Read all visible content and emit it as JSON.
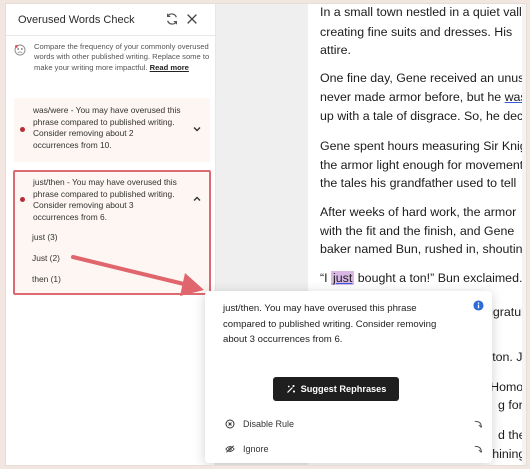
{
  "panel": {
    "title": "Overused Words Check",
    "refresh_icon": "refresh-icon",
    "close_icon": "close-icon",
    "intro": "Compare the frequency of your commonly overused words with other published writing. Replace some to make your writing more impactful.",
    "read_more": "Read more"
  },
  "cards": [
    {
      "text": "was/were - You may have overused this phrase compared to published writing. Consider removing about 2 occurrences from 10.",
      "expanded": false
    },
    {
      "text": "just/then - You may have overused this phrase compared to published writing. Consider removing about 3 occurrences from 6.",
      "expanded": true,
      "occurrences": [
        "just (3)",
        "Just (2)",
        "then (1)"
      ]
    }
  ],
  "document": {
    "lines": [
      "In a small town nestled in a quiet valley,",
      "creating fine suits and dresses. His",
      "attire.",
      "One fine day, Gene received an unusual",
      "never made armor before, but he",
      "up with a tale of disgrace. So, he decided",
      "Gene spent hours measuring Sir Knight",
      "the armor light enough for movement",
      "the tales his grandfather used to tell",
      "After weeks of hard work, the armor",
      "with the fit and the finish, and Gene",
      "baker named Bun, rushed in, shouting",
      "bought a ton!” Bun exclaimed."
    ],
    "underlined_word": "was",
    "quote_open": "“I",
    "highlight_word": "just",
    "hidden_fragments": [
      "ngratula",
      "l ton. Ju",
      "“Homo",
      "g for",
      "d the",
      "shining"
    ]
  },
  "popup": {
    "message": "just/then. You may have overused this phrase compared to published writing. Consider removing about 3 occurrences from 6.",
    "suggest_label": "Suggest Rephrases",
    "disable_label": "Disable Rule",
    "ignore_label": "Ignore"
  },
  "colors": {
    "accent_red": "#dc6b71",
    "dot_red": "#b62d35",
    "card_bg": "#fdf6f2",
    "highlight": "#d9b8e6",
    "info_blue": "#2f6bd6"
  }
}
